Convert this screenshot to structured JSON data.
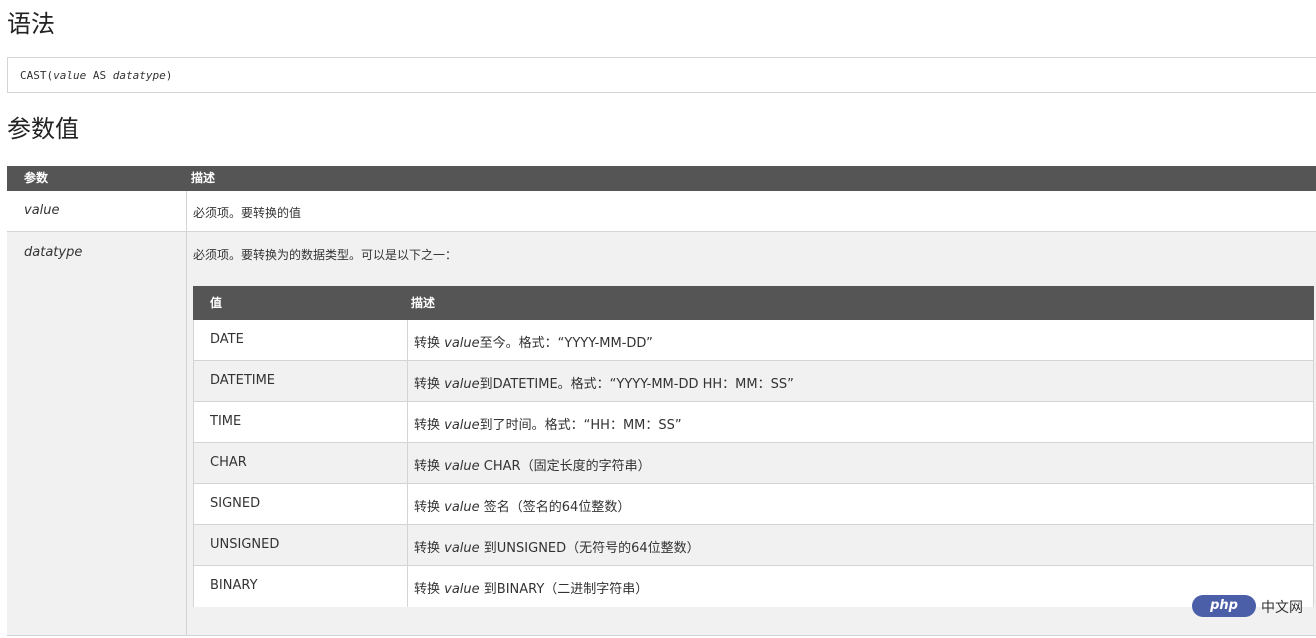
{
  "syntax": {
    "heading": "语法",
    "code_fn": "CAST(",
    "code_value": "value",
    "code_as": " AS ",
    "code_type": "datatype",
    "code_end": ")"
  },
  "params": {
    "heading": "参数值",
    "columns": [
      "参数",
      "描述"
    ],
    "rows": [
      {
        "name": "value",
        "desc": "必须项。要转换的值"
      },
      {
        "name": "datatype",
        "desc": "必须项。要转换为的数据类型。可以是以下之一："
      }
    ]
  },
  "datatypes": {
    "columns": [
      "值",
      "描述"
    ],
    "rows": [
      {
        "value": "DATE",
        "pre": "转换 ",
        "em": "value",
        "post": "至今。格式：“YYYY-MM-DD”"
      },
      {
        "value": "DATETIME",
        "pre": "转换 ",
        "em": "value",
        "post": "到DATETIME。格式：“YYYY-MM-DD HH：MM：SS”"
      },
      {
        "value": "TIME",
        "pre": "转换 ",
        "em": "value",
        "post": "到了时间。格式：“HH：MM：SS”"
      },
      {
        "value": "CHAR",
        "pre": "转换 ",
        "em": "value",
        "post": " CHAR（固定长度的字符串）"
      },
      {
        "value": "SIGNED",
        "pre": "转换 ",
        "em": "value",
        "post": " 签名（签名的64位整数）"
      },
      {
        "value": "UNSIGNED",
        "pre": "转换 ",
        "em": "value",
        "post": " 到UNSIGNED（无符号的64位整数）"
      },
      {
        "value": "BINARY",
        "pre": "转换 ",
        "em": "value",
        "post": " 到BINARY（二进制字符串）"
      }
    ]
  },
  "watermark": {
    "logo": "php",
    "site": "中文网"
  }
}
